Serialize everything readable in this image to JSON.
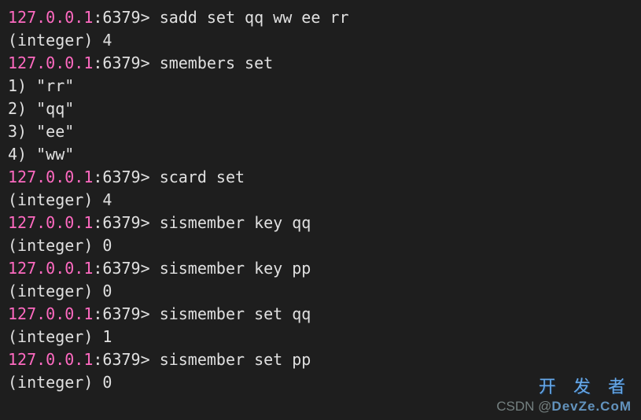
{
  "prompt": {
    "ip": "127.0.0.1",
    "sep": ":",
    "port": "6379",
    "suffix": "> "
  },
  "lines": [
    {
      "type": "cmd",
      "command": "sadd set qq ww ee rr"
    },
    {
      "type": "out",
      "text": "(integer) 4"
    },
    {
      "type": "cmd",
      "command": "smembers set"
    },
    {
      "type": "out",
      "text": "1) \"rr\""
    },
    {
      "type": "out",
      "text": "2) \"qq\""
    },
    {
      "type": "out",
      "text": "3) \"ee\""
    },
    {
      "type": "out",
      "text": "4) \"ww\""
    },
    {
      "type": "cmd",
      "command": "scard set"
    },
    {
      "type": "out",
      "text": "(integer) 4"
    },
    {
      "type": "cmd",
      "command": "sismember key qq"
    },
    {
      "type": "out",
      "text": "(integer) 0"
    },
    {
      "type": "cmd",
      "command": "sismember key pp"
    },
    {
      "type": "out",
      "text": "(integer) 0"
    },
    {
      "type": "cmd",
      "command": "sismember set qq"
    },
    {
      "type": "out",
      "text": "(integer) 1"
    },
    {
      "type": "cmd",
      "command": "sismember set pp"
    },
    {
      "type": "out",
      "text": "(integer) 0"
    }
  ],
  "watermark": {
    "top": "开 发 者",
    "bottom_prefix": "CSDN @",
    "bottom_brand": "DevZe.CoM"
  }
}
